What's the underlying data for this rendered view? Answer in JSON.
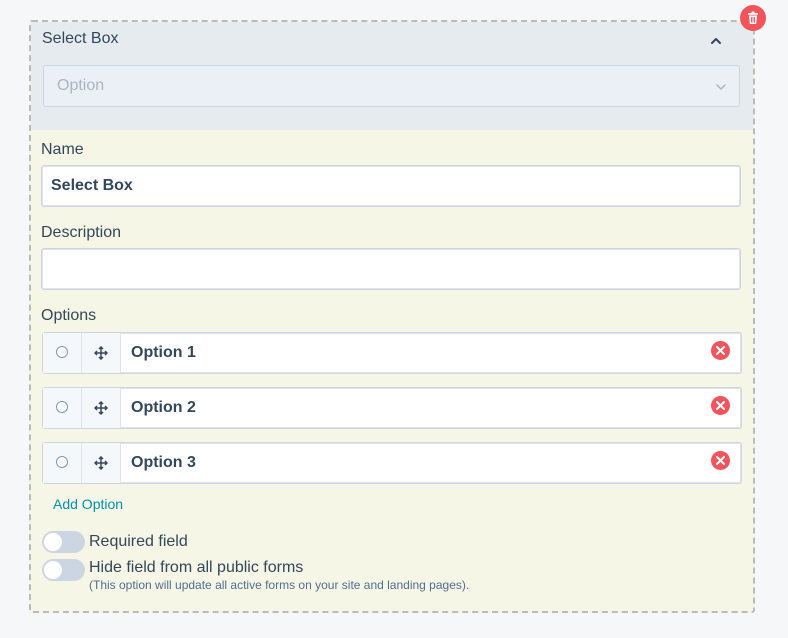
{
  "preview": {
    "title": "Select Box",
    "select_placeholder": "Option"
  },
  "form": {
    "name_label": "Name",
    "name_value": "Select Box",
    "description_label": "Description",
    "description_value": "",
    "options_label": "Options",
    "options": [
      {
        "label": "Option 1"
      },
      {
        "label": "Option 2"
      },
      {
        "label": "Option 3"
      }
    ],
    "add_option": "Add Option",
    "required_label": "Required field",
    "required_on": false,
    "hide_label": "Hide field from all public forms",
    "hide_help": "(This option will update all active forms on your site and landing pages).",
    "hide_on": false
  },
  "colors": {
    "danger": "#f2545b",
    "link": "#0091ae",
    "panel": "#f5f6e6",
    "preview_bg": "#e6ebef"
  },
  "icons": [
    "trash-icon",
    "chevron-up-icon",
    "chevron-down-icon",
    "move-icon",
    "close-icon"
  ]
}
